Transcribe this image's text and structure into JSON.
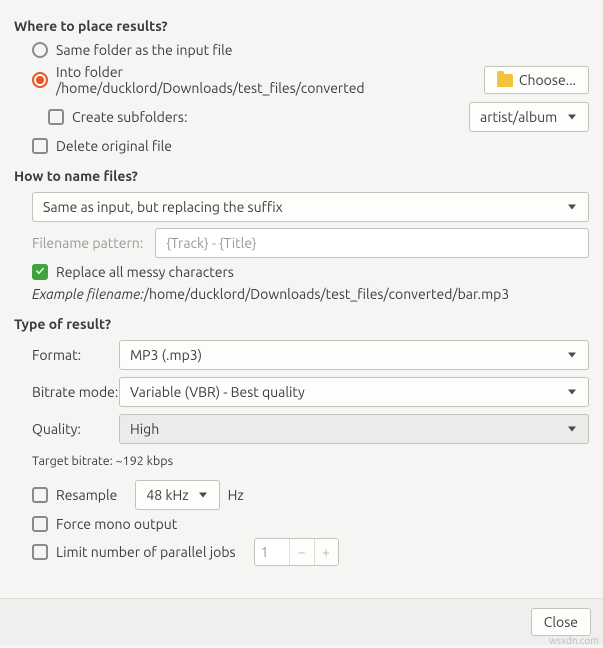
{
  "place": {
    "title": "Where to place results?",
    "same_folder": "Same folder as the input file",
    "into_folder_prefix": "Into folder ",
    "into_folder_path": "/home/ducklord/Downloads/test_files/converted",
    "choose": "Choose...",
    "create_subfolders": "Create subfolders:",
    "subfolder_pattern": "artist/album",
    "delete_original": "Delete original file"
  },
  "name": {
    "title": "How to name files?",
    "mode": "Same as input, but replacing the suffix",
    "pattern_label": "Filename pattern:",
    "pattern_value": "{Track} - {Title}",
    "replace_messy": "Replace all messy characters",
    "example_label": "Example filename: ",
    "example_value": "/home/ducklord/Downloads/test_files/converted/bar.mp3"
  },
  "result": {
    "title": "Type of result?",
    "format_label": "Format:",
    "format_value": "MP3 (.mp3)",
    "bitrate_mode_label": "Bitrate mode:",
    "bitrate_mode_value": "Variable (VBR) - Best quality",
    "quality_label": "Quality:",
    "quality_value": "High",
    "target_bitrate": "Target bitrate: ~192 kbps",
    "resample": "Resample",
    "resample_value": "48 kHz",
    "hz": "Hz",
    "force_mono": "Force mono output",
    "limit_jobs": "Limit number of parallel jobs",
    "limit_value": "1"
  },
  "footer": {
    "close": "Close"
  },
  "watermark": "wsxdn.com"
}
